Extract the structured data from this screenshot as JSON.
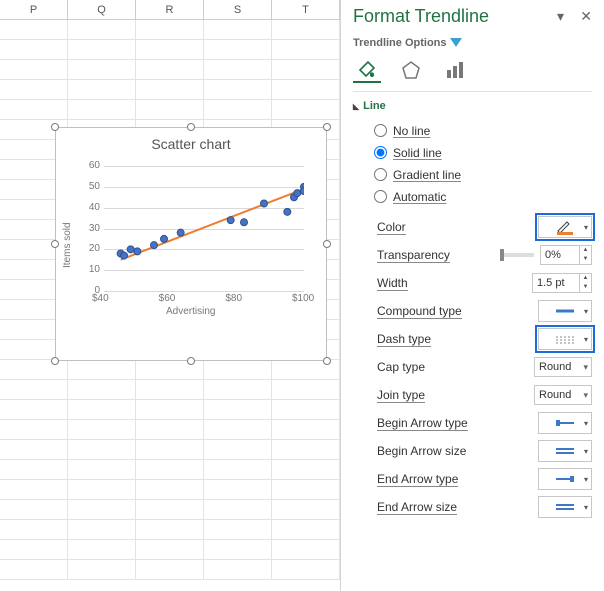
{
  "cols": [
    "P",
    "Q",
    "R",
    "S",
    "T"
  ],
  "chart": {
    "title": "Scatter chart",
    "xlabel": "Advertising",
    "ylabel": "Items sold"
  },
  "chart_data": {
    "type": "scatter",
    "x": [
      45,
      46,
      48,
      50,
      55,
      58,
      63,
      78,
      82,
      88,
      95,
      97,
      98,
      100,
      100
    ],
    "y": [
      18,
      17,
      20,
      19,
      22,
      25,
      28,
      34,
      33,
      42,
      38,
      45,
      47,
      50,
      48
    ],
    "trendline": {
      "x1": 45,
      "y1": 15,
      "x2": 100,
      "y2": 49,
      "color": "#ed7d31"
    },
    "xlim": [
      40,
      100
    ],
    "xticks": [
      40,
      60,
      80,
      100
    ],
    "ylim": [
      0,
      60
    ],
    "yticks": [
      0,
      10,
      20,
      30,
      40,
      50,
      60
    ],
    "xlabel": "Advertising",
    "ylabel": "Items sold"
  },
  "pane": {
    "title": "Format Trendline",
    "subtitle": "Trendline Options",
    "section": "Line",
    "radios": {
      "none": "No line",
      "solid": "Solid line",
      "grad": "Gradient line",
      "auto": "Automatic",
      "selected": "solid"
    },
    "color_lbl": "Color",
    "trans_lbl": "Transparency",
    "trans_val": "0%",
    "width_lbl": "Width",
    "width_val": "1.5 pt",
    "compound_lbl": "Compound type",
    "dash_lbl": "Dash type",
    "cap_lbl": "Cap type",
    "cap_val": "Round",
    "join_lbl": "Join type",
    "join_val": "Round",
    "beginarrow_lbl": "Begin Arrow type",
    "beginsize_lbl": "Begin Arrow size",
    "endarrow_lbl": "End Arrow type",
    "endsize_lbl": "End Arrow size"
  }
}
